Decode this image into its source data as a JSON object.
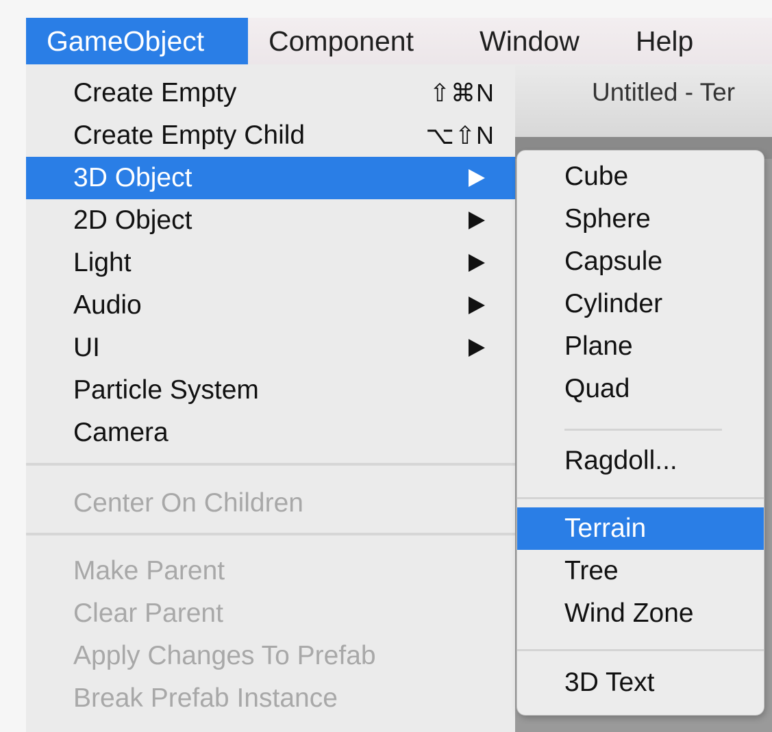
{
  "menubar": {
    "items": [
      {
        "label": "GameObject",
        "active": true
      },
      {
        "label": "Component",
        "active": false
      },
      {
        "label": "Window",
        "active": false
      },
      {
        "label": "Help",
        "active": false
      }
    ]
  },
  "editor": {
    "title": "Untitled - Ter"
  },
  "gameobject_menu": {
    "items": [
      {
        "label": "Create Empty",
        "shortcut": "⇧⌘N",
        "state": "enabled"
      },
      {
        "label": "Create Empty Child",
        "shortcut": "⌥⇧N",
        "state": "enabled"
      },
      {
        "label": "3D Object",
        "submenu": true,
        "state": "highlighted"
      },
      {
        "label": "2D Object",
        "submenu": true,
        "state": "enabled"
      },
      {
        "label": "Light",
        "submenu": true,
        "state": "enabled"
      },
      {
        "label": "Audio",
        "submenu": true,
        "state": "enabled"
      },
      {
        "label": "UI",
        "submenu": true,
        "state": "enabled"
      },
      {
        "label": "Particle System",
        "state": "enabled"
      },
      {
        "label": "Camera",
        "state": "enabled"
      },
      {
        "label": "Center On Children",
        "state": "disabled"
      },
      {
        "label": "Make Parent",
        "state": "disabled"
      },
      {
        "label": "Clear Parent",
        "state": "disabled"
      },
      {
        "label": "Apply Changes To Prefab",
        "state": "disabled"
      },
      {
        "label": "Break Prefab Instance",
        "state": "disabled"
      }
    ]
  },
  "submenu_3d_object": {
    "items": [
      {
        "label": "Cube",
        "state": "enabled"
      },
      {
        "label": "Sphere",
        "state": "enabled"
      },
      {
        "label": "Capsule",
        "state": "enabled"
      },
      {
        "label": "Cylinder",
        "state": "enabled"
      },
      {
        "label": "Plane",
        "state": "enabled"
      },
      {
        "label": "Quad",
        "state": "enabled"
      },
      {
        "label": "Ragdoll...",
        "state": "enabled"
      },
      {
        "label": "Terrain",
        "state": "highlighted"
      },
      {
        "label": "Tree",
        "state": "enabled"
      },
      {
        "label": "Wind Zone",
        "state": "enabled"
      },
      {
        "label": "3D Text",
        "state": "enabled"
      }
    ]
  },
  "colors": {
    "highlight": "#2a7ee6",
    "menu_bg": "#ebebeb",
    "disabled_text": "#a8a8a8"
  }
}
